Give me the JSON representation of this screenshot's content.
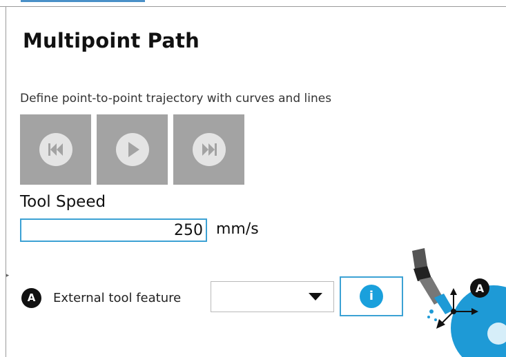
{
  "title": "Multipoint Path",
  "description": "Define point-to-point trajectory with curves and lines",
  "controls": [
    {
      "name": "skip-back-button",
      "icon": "skip-back-icon"
    },
    {
      "name": "play-button",
      "icon": "play-icon"
    },
    {
      "name": "skip-forward-button",
      "icon": "skip-forward-icon"
    }
  ],
  "tool_speed": {
    "label": "Tool Speed",
    "value": "250",
    "unit": "mm/s"
  },
  "external_tool": {
    "marker": "A",
    "label": "External tool feature",
    "selected_value": "",
    "info_label": "i"
  },
  "illustration": {
    "marker": "A"
  },
  "colors": {
    "accent": "#3ba1d4",
    "info_button": "#1aa0dc",
    "control_bg": "#a3a3a3",
    "illustration_blue": "#1e9ad6"
  }
}
